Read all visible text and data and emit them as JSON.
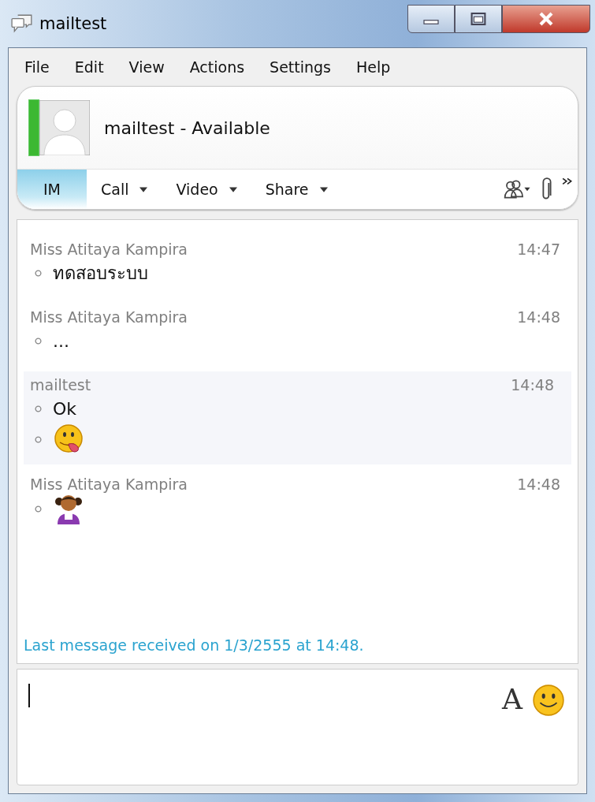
{
  "window": {
    "title": "mailtest"
  },
  "menu": [
    {
      "label": "File"
    },
    {
      "label": "Edit"
    },
    {
      "label": "View"
    },
    {
      "label": "Actions"
    },
    {
      "label": "Settings"
    },
    {
      "label": "Help"
    }
  ],
  "contact": {
    "name_status": "mailtest - Available"
  },
  "toolbar": {
    "tabs": [
      {
        "label": "IM",
        "selected": true,
        "dropdown": false
      },
      {
        "label": "Call",
        "selected": false,
        "dropdown": true
      },
      {
        "label": "Video",
        "selected": false,
        "dropdown": true
      },
      {
        "label": "Share",
        "selected": false,
        "dropdown": true
      }
    ]
  },
  "messages": [
    {
      "sender": "Miss Atitaya Kampira",
      "time": "14:47",
      "highlighted": false,
      "lines": [
        {
          "kind": "text",
          "text": "ทดสอบระบบ"
        }
      ]
    },
    {
      "sender": "Miss Atitaya Kampira",
      "time": "14:48",
      "highlighted": false,
      "lines": [
        {
          "kind": "text",
          "text": "..."
        }
      ]
    },
    {
      "sender": "mailtest",
      "time": "14:48",
      "highlighted": true,
      "lines": [
        {
          "kind": "text",
          "text": "Ok"
        },
        {
          "kind": "tongue"
        }
      ]
    },
    {
      "sender": "Miss Atitaya Kampira",
      "time": "14:48",
      "highlighted": false,
      "lines": [
        {
          "kind": "girl"
        }
      ]
    }
  ],
  "status": "Last message received on 1/3/2555 at 14:48.",
  "compose": {
    "font_button": "A"
  }
}
